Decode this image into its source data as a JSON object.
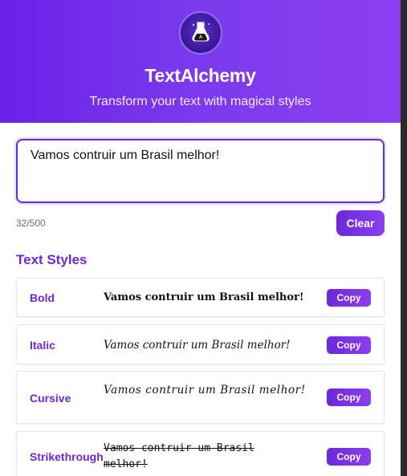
{
  "header": {
    "title": "TextAlchemy",
    "subtitle": "Transform your text with magical styles",
    "logo_icon": "alchemy-flask-icon"
  },
  "input": {
    "value": "Vamos contruir um Brasil melhor!",
    "char_count": "32/500",
    "clear_label": "Clear"
  },
  "styles_section": {
    "title": "Text Styles",
    "items": [
      {
        "name": "Bold",
        "preview": "Vamos contruir um Brasil melhor!",
        "copy_label": "Copy"
      },
      {
        "name": "Italic",
        "preview": "Vamos contruir um Brasil melhor!",
        "copy_label": "Copy"
      },
      {
        "name": "Cursive",
        "preview": "Vamos contruir um Brasil melhor!",
        "copy_label": "Copy"
      },
      {
        "name": "Strikethrough",
        "preview": "Vamos contruir um Brasil melhor!",
        "copy_label": "Copy"
      }
    ]
  },
  "colors": {
    "accent": "#6d28d9",
    "header_gradient_start": "#6b21e8",
    "header_gradient_end": "#8b3ff0"
  }
}
